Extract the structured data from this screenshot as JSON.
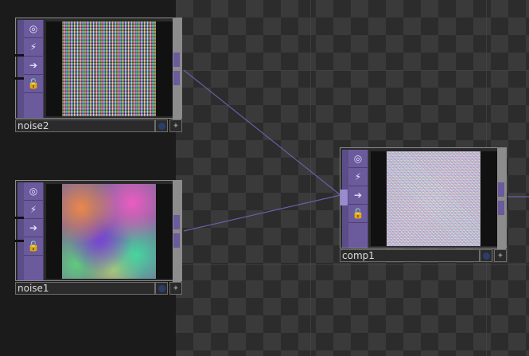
{
  "nodes": {
    "noise2": {
      "name": "noise2"
    },
    "noise1": {
      "name": "noise1"
    },
    "comp1": {
      "name": "comp1"
    }
  },
  "node_buttons": [
    "viewer-toggle",
    "bypass",
    "cook",
    "lock"
  ],
  "colors": {
    "op_family_purple": "#6b5a9c",
    "wire": "#6a5fa8",
    "background_dark": "#1b1b1b"
  }
}
